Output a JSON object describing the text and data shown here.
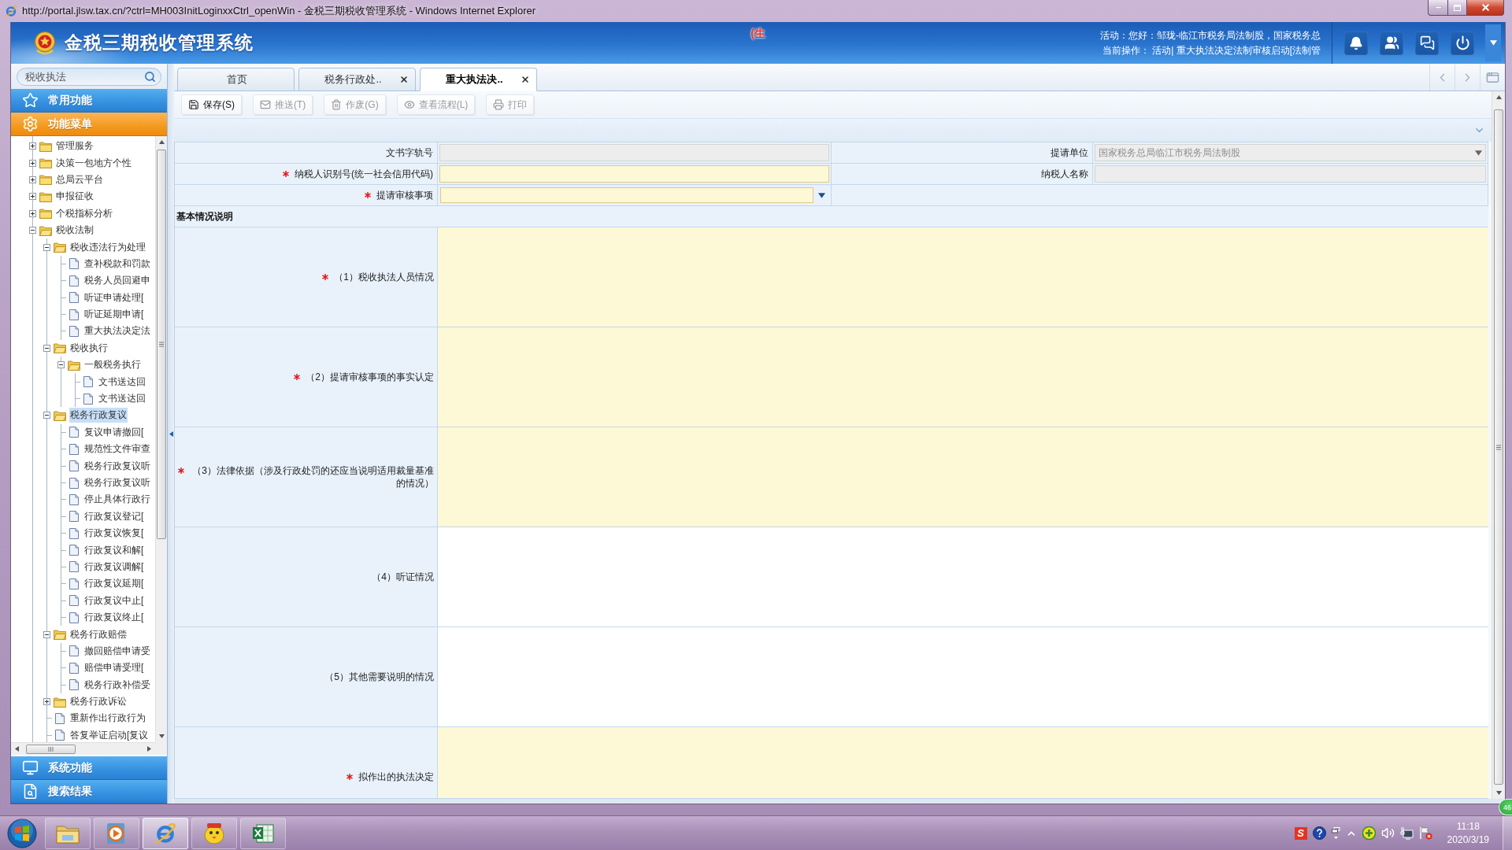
{
  "window": {
    "title": "http://portal.jlsw.tax.cn/?ctrl=MH003InitLoginxxCtrl_openWin - 金税三期税收管理系统 - Windows Internet Explorer"
  },
  "header": {
    "system_name": "金税三期税收管理系统",
    "environment_tag": "(生",
    "user_line": "活动：您好：邹珑-临江市税务局法制股，国家税务总",
    "operation_line": "当前操作： 活动| 重大执法决定法制审核启动[法制管"
  },
  "sidebar": {
    "search": {
      "value": "税收执法"
    },
    "panels": [
      {
        "label": "常用功能",
        "kind": "favorites",
        "expanded": false
      },
      {
        "label": "功能菜单",
        "kind": "menu",
        "expanded": true,
        "tree": [
          {
            "label": "管理服务",
            "kind": "folder",
            "expanded": false,
            "selected": false
          },
          {
            "label": "决策一包地方个性",
            "kind": "folder",
            "expanded": false,
            "selected": false
          },
          {
            "label": "总局云平台",
            "kind": "folder",
            "expanded": false,
            "selected": false
          },
          {
            "label": "申报征收",
            "kind": "folder",
            "expanded": false,
            "selected": false
          },
          {
            "label": "个税指标分析",
            "kind": "folder",
            "expanded": false,
            "selected": false
          },
          {
            "label": "税收法制",
            "kind": "folder",
            "expanded": true,
            "selected": false,
            "children": [
              {
                "label": "税收违法行为处理",
                "kind": "folder",
                "expanded": true,
                "selected": false,
                "children": [
                  {
                    "label": "查补税款和罚款",
                    "kind": "document",
                    "selected": false
                  },
                  {
                    "label": "税务人员回避申",
                    "kind": "document",
                    "selected": false
                  },
                  {
                    "label": "听证申请处理[",
                    "kind": "document",
                    "selected": false
                  },
                  {
                    "label": "听证延期申请[",
                    "kind": "document",
                    "selected": false
                  },
                  {
                    "label": "重大执法决定法",
                    "kind": "document",
                    "selected": false
                  }
                ]
              },
              {
                "label": "税收执行",
                "kind": "folder",
                "expanded": true,
                "selected": false,
                "children": [
                  {
                    "label": "一般税务执行",
                    "kind": "folder",
                    "expanded": true,
                    "selected": false,
                    "children": [
                      {
                        "label": "文书送达回",
                        "kind": "document",
                        "selected": false
                      },
                      {
                        "label": "文书送达回",
                        "kind": "document",
                        "selected": false
                      }
                    ]
                  }
                ]
              },
              {
                "label": "税务行政复议",
                "kind": "folder",
                "expanded": true,
                "selected": true,
                "children": [
                  {
                    "label": "复议申请撤回[",
                    "kind": "document",
                    "selected": false
                  },
                  {
                    "label": "规范性文件审查",
                    "kind": "document",
                    "selected": false
                  },
                  {
                    "label": "税务行政复议听",
                    "kind": "document",
                    "selected": false
                  },
                  {
                    "label": "税务行政复议听",
                    "kind": "document",
                    "selected": false
                  },
                  {
                    "label": "停止具体行政行",
                    "kind": "document",
                    "selected": false
                  },
                  {
                    "label": "行政复议登记[",
                    "kind": "document",
                    "selected": false
                  },
                  {
                    "label": "行政复议恢复[",
                    "kind": "document",
                    "selected": false
                  },
                  {
                    "label": "行政复议和解[",
                    "kind": "document",
                    "selected": false
                  },
                  {
                    "label": "行政复议调解[",
                    "kind": "document",
                    "selected": false
                  },
                  {
                    "label": "行政复议延期[",
                    "kind": "document",
                    "selected": false
                  },
                  {
                    "label": "行政复议中止[",
                    "kind": "document",
                    "selected": false
                  },
                  {
                    "label": "行政复议终止[",
                    "kind": "document",
                    "selected": false
                  }
                ]
              },
              {
                "label": "税务行政赔偿",
                "kind": "folder",
                "expanded": true,
                "selected": false,
                "children": [
                  {
                    "label": "撤回赔偿申请受",
                    "kind": "document",
                    "selected": false
                  },
                  {
                    "label": "赔偿申请受理[",
                    "kind": "document",
                    "selected": false
                  },
                  {
                    "label": "税务行政补偿受",
                    "kind": "document",
                    "selected": false
                  }
                ]
              },
              {
                "label": "税务行政诉讼",
                "kind": "folder",
                "expanded": false,
                "selected": false
              },
              {
                "label": "重新作出行政行为",
                "kind": "document",
                "selected": false
              },
              {
                "label": "答复举证启动[复议",
                "kind": "document",
                "selected": false
              }
            ]
          }
        ]
      },
      {
        "label": "系统功能",
        "kind": "system",
        "expanded": false
      },
      {
        "label": "搜索结果",
        "kind": "search",
        "expanded": false
      }
    ]
  },
  "tabs": [
    {
      "label": "首页",
      "selected": false,
      "closable": false
    },
    {
      "label": "税务行政处..",
      "selected": false,
      "closable": true
    },
    {
      "label": "重大执法决..",
      "selected": true,
      "closable": true
    }
  ],
  "toolbar": [
    {
      "label": "保存(S)",
      "kind": "save",
      "disabled": false
    },
    {
      "label": "推送(T)",
      "kind": "send",
      "disabled": true
    },
    {
      "label": "作废(G)",
      "kind": "void",
      "disabled": true
    },
    {
      "label": "查看流程(L)",
      "kind": "view",
      "disabled": true
    },
    {
      "label": "打印",
      "kind": "print",
      "disabled": true
    }
  ],
  "form": {
    "rows": [
      {
        "cells": [
          {
            "label": "文书字轨号",
            "kind": "text",
            "required": false,
            "readonly": true
          },
          {
            "label": "提请单位",
            "kind": "select",
            "required": false,
            "readonly": true,
            "value": "国家税务总局临江市税务局法制股"
          }
        ]
      },
      {
        "cells": [
          {
            "label": "纳税人识别号(统一社会信用代码)",
            "kind": "text",
            "required": true,
            "readonly": false
          },
          {
            "label": "纳税人名称",
            "kind": "text",
            "required": false,
            "readonly": true
          }
        ]
      },
      {
        "cells": [
          {
            "label": "提请审核事项",
            "kind": "select",
            "required": true,
            "readonly": false
          }
        ]
      }
    ],
    "section_title": "基本情况说明",
    "descriptions": [
      {
        "label": "（1）税收执法人员情况",
        "required": true
      },
      {
        "label": "（2）提请审核事项的事实认定",
        "required": true
      },
      {
        "label": "（3）法律依据（涉及行政处罚的还应当说明适用裁量基准的情况）",
        "required": true
      },
      {
        "label": "（4）听证情况",
        "required": false
      },
      {
        "label": "（5）其他需要说明的情况",
        "required": false
      },
      {
        "label": "拟作出的执法决定",
        "required": true
      }
    ]
  },
  "floating_widget": {
    "text": "46"
  },
  "taskbar": {
    "apps": [
      {
        "kind": "explorer",
        "active": false
      },
      {
        "kind": "media",
        "active": false
      },
      {
        "kind": "browser",
        "active": true
      },
      {
        "kind": "ftp",
        "active": false
      },
      {
        "kind": "spreadsheet",
        "active": false
      }
    ],
    "tray": {
      "ime_label": "S"
    },
    "clock": {
      "time": "11:18",
      "date": "2020/3/19"
    }
  }
}
